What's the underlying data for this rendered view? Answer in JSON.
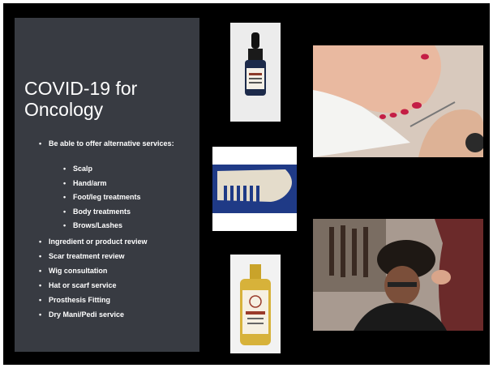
{
  "slide": {
    "title": "COVID-19 for Oncology",
    "intro_bullet": "Be able to offer alternative services:",
    "sub_bullets": [
      "Scalp",
      "Hand/arm",
      "Foot/leg treatments",
      "Body treatments",
      "Brows/Lashes"
    ],
    "bullets": [
      "Ingredient or product review",
      "Scar treatment review",
      "Wig consultation",
      "Hat or scarf service",
      "Prosthesis Fitting",
      "Dry Mani/Pedi service"
    ]
  },
  "images": {
    "dropper": "dropper-bottle-photo",
    "nails": "pedicure-photo",
    "comb": "stone-comb-photo",
    "bottle": "oil-bottle-photo",
    "hair": "hair-styling-photo"
  },
  "colors": {
    "panel": "#383b42",
    "background": "#000000",
    "text": "#ffffff"
  }
}
